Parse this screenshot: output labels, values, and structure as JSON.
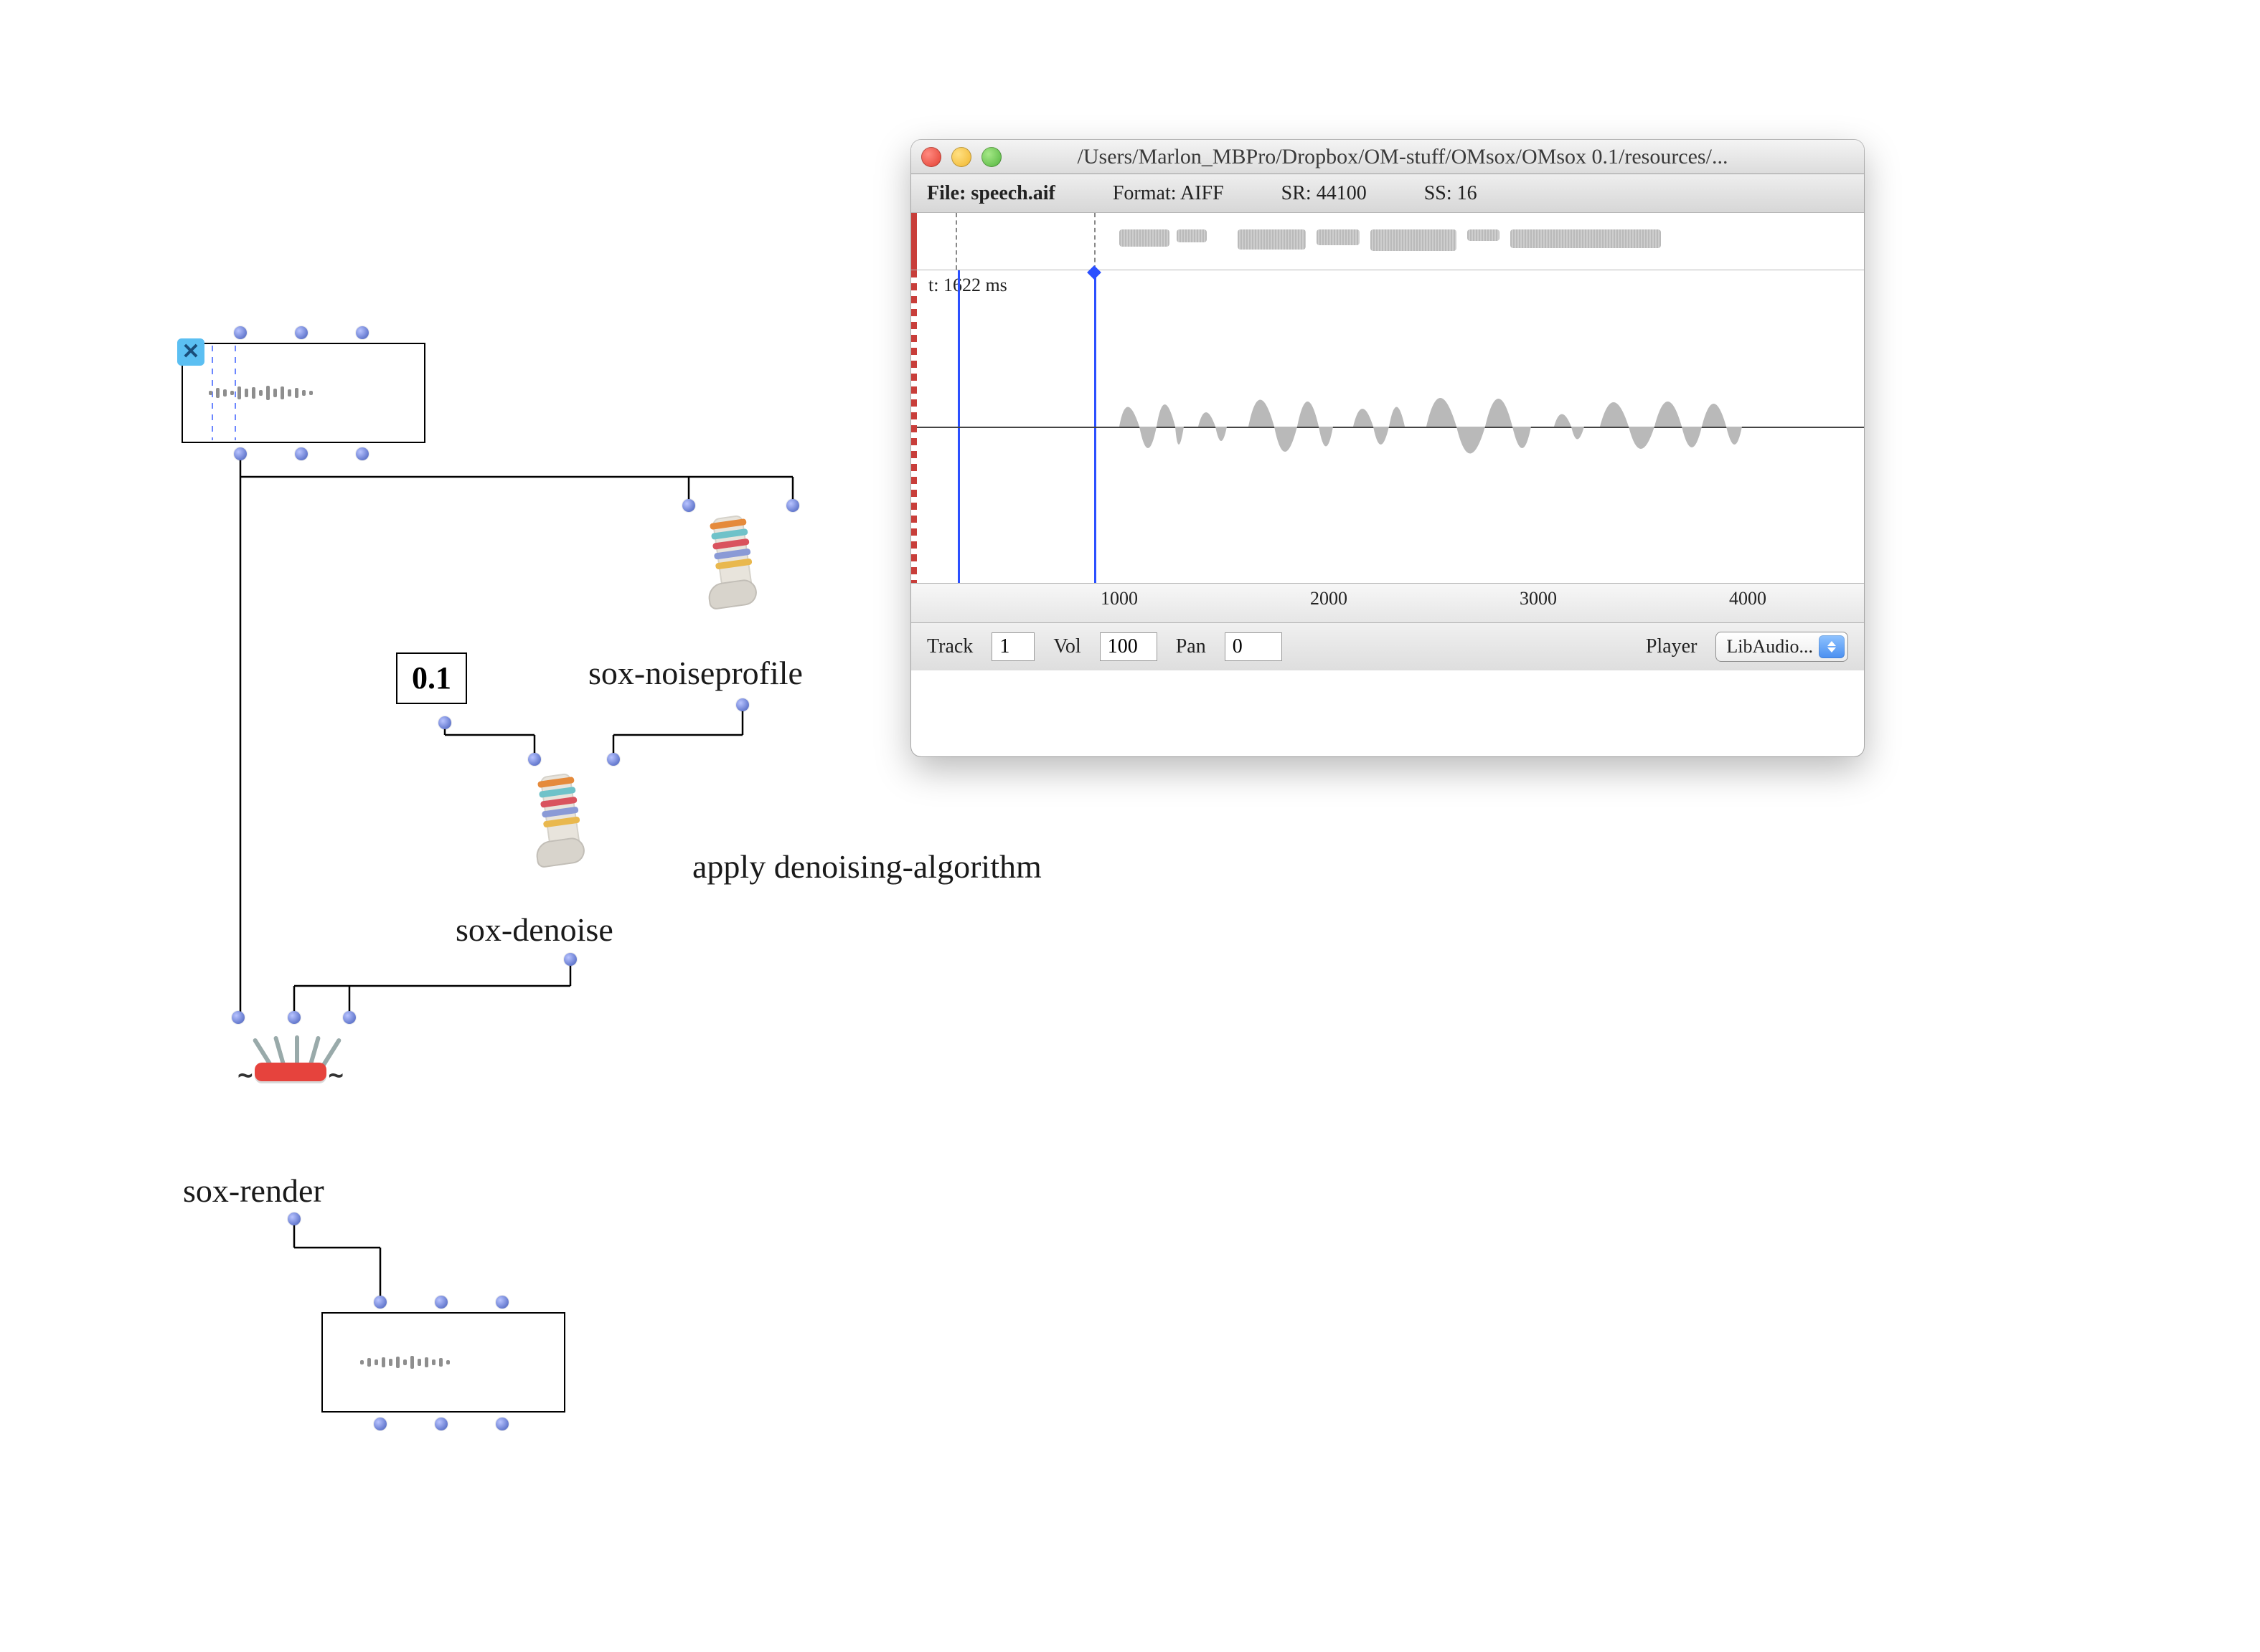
{
  "patch": {
    "numbox_value": "0.1",
    "noiseprofile_label": "sox-noiseprofile",
    "denoise_label": "sox-denoise",
    "render_label": "sox-render",
    "comment_text": "apply denoising-algorithm"
  },
  "sound_window": {
    "title": "/Users/Marlon_MBPro/Dropbox/OM-stuff/OMsox/OMsox 0.1/resources/...",
    "file_label": "File: ",
    "file_name": "speech.aif",
    "format": "Format: AIFF",
    "sr": "SR: 44100",
    "ss": "SS: 16",
    "time_label": "t: 1622 ms",
    "ruler": {
      "t1": "1000",
      "t2": "2000",
      "t3": "3000",
      "t4": "4000"
    },
    "track_label": "Track",
    "track_value": "1",
    "vol_label": "Vol",
    "vol_value": "100",
    "pan_label": "Pan",
    "pan_value": "0",
    "player_label": "Player",
    "player_value": "LibAudio..."
  }
}
